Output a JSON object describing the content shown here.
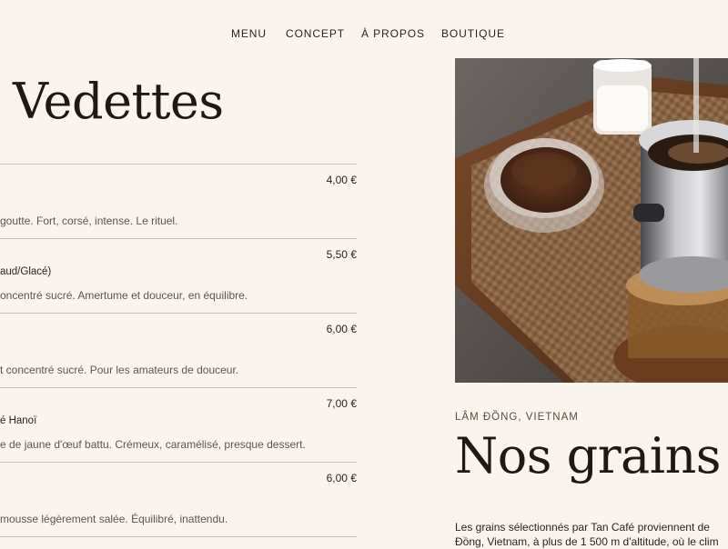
{
  "nav": {
    "items": [
      {
        "label": "MENU"
      },
      {
        "label": "CONCEPT"
      },
      {
        "label": "À PROPOS"
      },
      {
        "label": "BOUTIQUE"
      }
    ]
  },
  "menu": {
    "title": "Vedettes",
    "items": [
      {
        "price": "4,00 €",
        "subtitle": "",
        "description": "goutte. Fort, corsé, intense. Le rituel."
      },
      {
        "price": "5,50 €",
        "subtitle": "aud/Glacé)",
        "description": "oncentré sucré. Amertume et douceur, en équilibre."
      },
      {
        "price": "6,00 €",
        "subtitle": "",
        "description": "t concentré sucré. Pour les amateurs de douceur."
      },
      {
        "price": "7,00 €",
        "subtitle": "é Hanoï",
        "description": "e de jaune d'œuf battu. Crémeux, caramélisé, presque dessert."
      },
      {
        "price": "6,00 €",
        "subtitle": "",
        "description": "mousse légèrement salée. Équilibré, inattendu."
      }
    ]
  },
  "image": {
    "description_icon": "coffee-photo"
  },
  "grains": {
    "origin": "LÂM ĐỒNG, VIETNAM",
    "title": "Nos grains",
    "body_line1": "Les grains sélectionnés par Tan Café proviennent de",
    "body_line2": "Đồng, Vietnam, à plus de 1 500 m d'altitude, où le clim"
  },
  "colors": {
    "background": "#faf4ef",
    "text": "#2a2220",
    "divider": "#c9bfb8"
  }
}
